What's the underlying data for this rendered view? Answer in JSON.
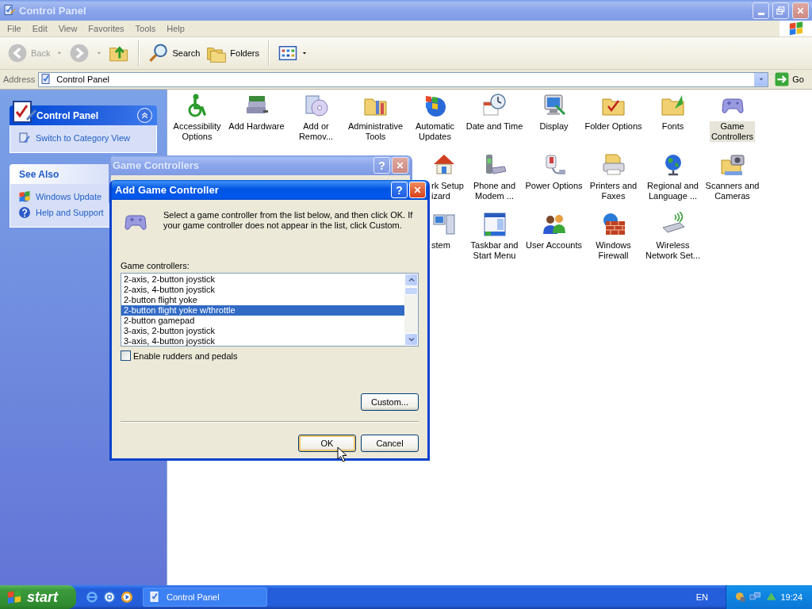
{
  "window": {
    "title": "Control Panel",
    "active": false
  },
  "menu": [
    "File",
    "Edit",
    "View",
    "Favorites",
    "Tools",
    "Help"
  ],
  "toolbar": {
    "back": {
      "label": "Back",
      "disabled": true
    },
    "forward": {
      "disabled": true
    },
    "search": "Search",
    "folders": "Folders"
  },
  "address": {
    "label": "Address",
    "value": "Control Panel",
    "go": "Go"
  },
  "sidebar": [
    {
      "title": "Control Panel",
      "kind": "primary",
      "links": [
        "Switch to Category View"
      ]
    },
    {
      "title": "See Also",
      "kind": "secondary",
      "links": [
        "Windows Update",
        "Help and Support"
      ]
    }
  ],
  "icon_rows": [
    [
      {
        "lines": [
          "Accessibility",
          "Options"
        ],
        "kind": "full",
        "selected": false
      },
      {
        "lines": [
          "Add Hardware"
        ],
        "kind": "full",
        "selected": false
      },
      {
        "lines": [
          "Add or",
          "Remov..."
        ],
        "kind": "full",
        "selected": false
      },
      {
        "lines": [
          "Administrative",
          "Tools"
        ],
        "kind": "full",
        "selected": false
      },
      {
        "lines": [
          "Automatic",
          "Updates"
        ],
        "kind": "full",
        "selected": false
      },
      {
        "lines": [
          "Date and Time"
        ],
        "kind": "full",
        "selected": false
      },
      {
        "lines": [
          "Display"
        ],
        "kind": "full",
        "selected": false
      },
      {
        "lines": [
          "Folder Options"
        ],
        "kind": "full",
        "selected": false
      },
      {
        "lines": [
          "Fonts"
        ],
        "kind": "full",
        "selected": false
      },
      {
        "lines": [
          "Game",
          "Controllers"
        ],
        "kind": "full",
        "selected": true
      }
    ],
    [
      {
        "lines": [
          "rk Setup",
          "izard"
        ],
        "kind": "partial",
        "selected": false
      },
      {
        "lines": [
          "Phone and",
          "Modem ..."
        ],
        "kind": "full",
        "selected": false
      },
      {
        "lines": [
          "Power Options"
        ],
        "kind": "full",
        "selected": false
      },
      {
        "lines": [
          "Printers and",
          "Faxes"
        ],
        "kind": "full",
        "selected": false
      },
      {
        "lines": [
          "Regional and",
          "Language ..."
        ],
        "kind": "full",
        "selected": false
      },
      {
        "lines": [
          "Scanners and",
          "Cameras"
        ],
        "kind": "full",
        "selected": false
      }
    ],
    [
      {
        "lines": [
          "stem"
        ],
        "kind": "partial",
        "selected": false
      },
      {
        "lines": [
          "Taskbar and",
          "Start Menu"
        ],
        "kind": "full",
        "selected": false
      },
      {
        "lines": [
          "User Accounts"
        ],
        "kind": "full",
        "selected": false
      },
      {
        "lines": [
          "Windows",
          "Firewall"
        ],
        "kind": "full",
        "selected": false
      },
      {
        "lines": [
          "Wireless",
          "Network Set..."
        ],
        "kind": "full",
        "selected": false
      }
    ]
  ],
  "back_window": {
    "title": "Game Controllers",
    "active": false,
    "help": "?"
  },
  "dialog": {
    "title": "Add Game Controller",
    "active": true,
    "help": "?",
    "message": "Select a game controller from the list below, and then click OK.  If your game controller does not appear in the list, click Custom.",
    "list_label": "Game controllers:",
    "list": [
      {
        "text": "2-axis, 2-button joystick",
        "selected": false
      },
      {
        "text": "2-axis, 4-button joystick",
        "selected": false
      },
      {
        "text": "2-button flight yoke",
        "selected": false
      },
      {
        "text": "2-button flight yoke w/throttle",
        "selected": true
      },
      {
        "text": "2-button gamepad",
        "selected": false
      },
      {
        "text": "3-axis, 2-button joystick",
        "selected": false
      },
      {
        "text": "3-axis, 4-button joystick",
        "selected": false
      }
    ],
    "checkbox": {
      "label": "Enable rudders and pedals",
      "checked": false
    },
    "custom_button": "Custom...",
    "buttons": [
      {
        "label": "OK",
        "focused": true
      },
      {
        "label": "Cancel",
        "focused": false
      }
    ]
  },
  "taskbar": {
    "start": "start",
    "tasks": [
      {
        "label": "Control Panel",
        "selected": false
      }
    ],
    "language": "EN",
    "clock": "19:24"
  }
}
